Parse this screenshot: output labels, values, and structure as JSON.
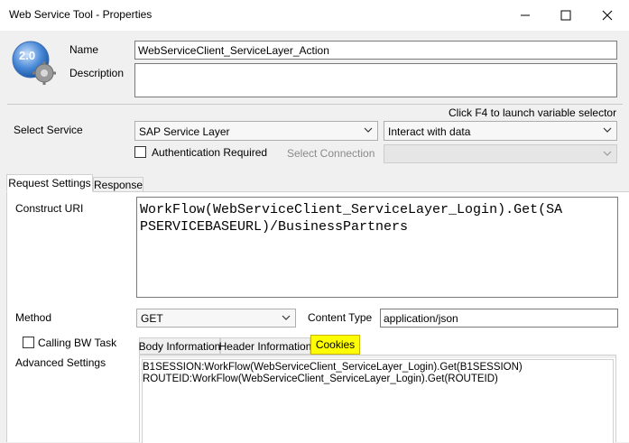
{
  "window": {
    "title": "Web Service Tool - Properties",
    "icon_version": "2.0"
  },
  "fields": {
    "name_label": "Name",
    "name_value": "WebServiceClient_ServiceLayer_Action",
    "description_label": "Description",
    "description_value": ""
  },
  "hint": "Click F4 to launch variable selector",
  "service": {
    "label": "Select Service",
    "value": "SAP Service Layer",
    "interaction_value": "Interact with data",
    "auth_label": "Authentication Required",
    "auth_checked": false,
    "connection_label": "Select Connection",
    "connection_value": ""
  },
  "main_tabs": [
    {
      "label": "Request Settings",
      "active": true
    },
    {
      "label": "Response",
      "active": false
    }
  ],
  "request": {
    "uri_label": "Construct URI",
    "uri_value": "WorkFlow(WebServiceClient_ServiceLayer_Login).Get(SAPSERVICEBASEURL)/BusinessPartners",
    "uri_line1": "WorkFlow(WebServiceClient_ServiceLayer_Login).Get(SA",
    "uri_line2": "PSERVICEBASEURL)/BusinessPartners",
    "method_label": "Method",
    "method_value": "GET",
    "content_type_label": "Content Type",
    "content_type_value": "application/json",
    "calling_bw_label": "Calling BW Task",
    "calling_bw_checked": false,
    "advanced_label": "Advanced Settings"
  },
  "advanced_tabs": [
    {
      "label": "Body Information",
      "active": false
    },
    {
      "label": "Header Information",
      "active": false
    },
    {
      "label": "Cookies",
      "active": true
    }
  ],
  "cookies": [
    "B1SESSION:WorkFlow(WebServiceClient_ServiceLayer_Login).Get(B1SESSION)",
    "ROUTEID:WorkFlow(WebServiceClient_ServiceLayer_Login).Get(ROUTEID)"
  ],
  "colors": {
    "highlight_tab": "#ffff00",
    "icon_blue": "#2a6fc9"
  }
}
